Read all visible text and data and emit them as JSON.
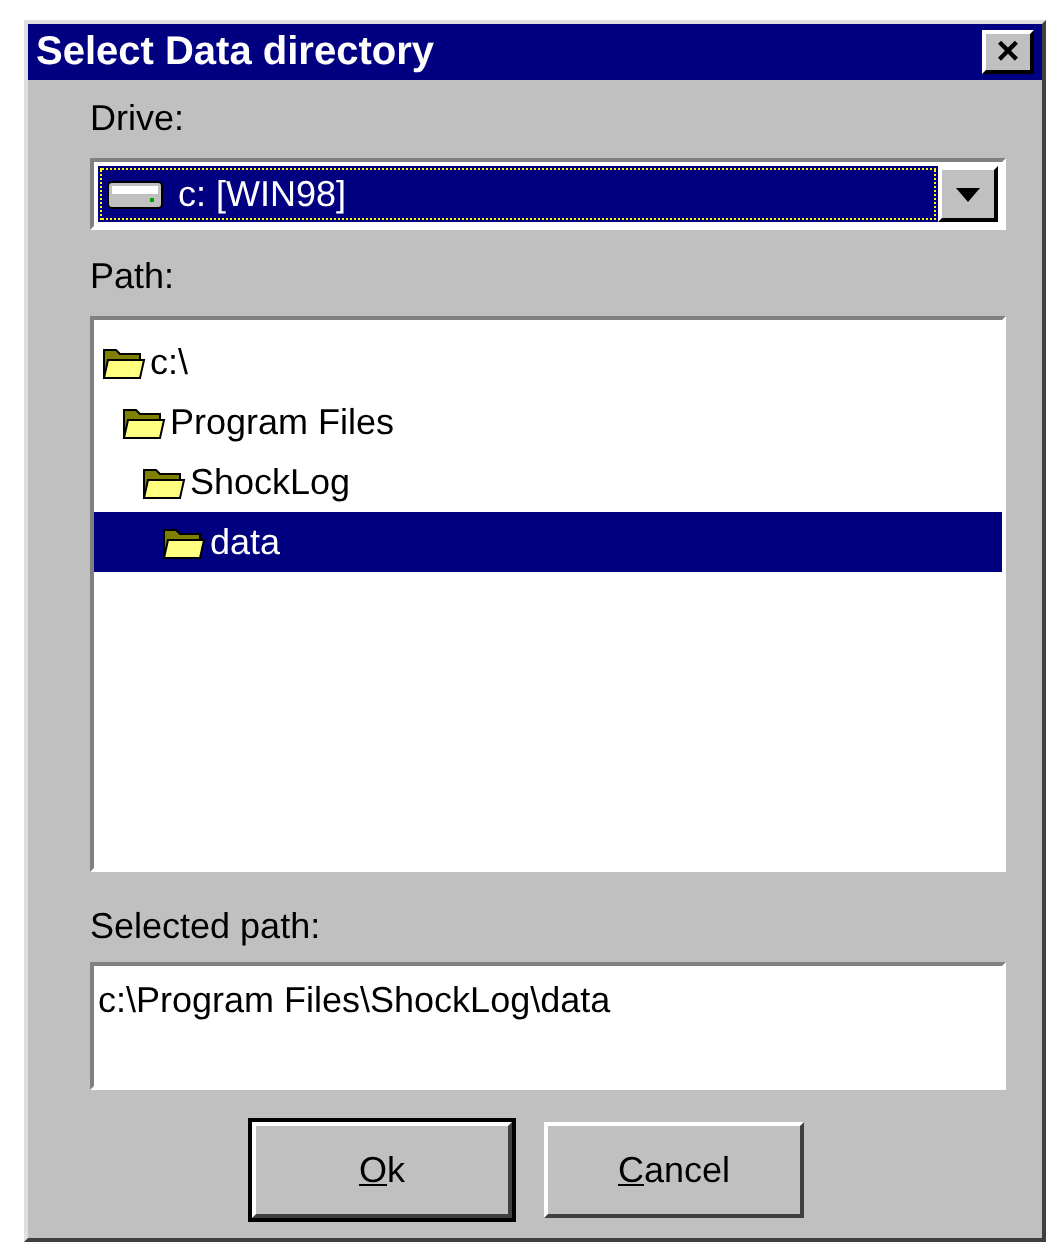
{
  "window": {
    "title": "Select Data directory",
    "close_button": "×"
  },
  "drive": {
    "label": "Drive:",
    "value": "c: [WIN98]",
    "focused": true
  },
  "path": {
    "label": "Path:",
    "tree": [
      {
        "label": "c:\\",
        "selected": false,
        "children": [
          {
            "label": "Program Files",
            "selected": false,
            "children": [
              {
                "label": "ShockLog",
                "selected": false,
                "children": [
                  {
                    "label": "data",
                    "selected": true
                  }
                ]
              }
            ]
          }
        ]
      }
    ]
  },
  "selected_path": {
    "label": "Selected path:",
    "value": "c:\\Program Files\\ShockLog\\data"
  },
  "buttons": [
    {
      "label": "Ok",
      "mnemonic_first_letter": true,
      "default": true
    },
    {
      "label": "Cancel",
      "mnemonic_first_letter": true,
      "default": false
    }
  ]
}
